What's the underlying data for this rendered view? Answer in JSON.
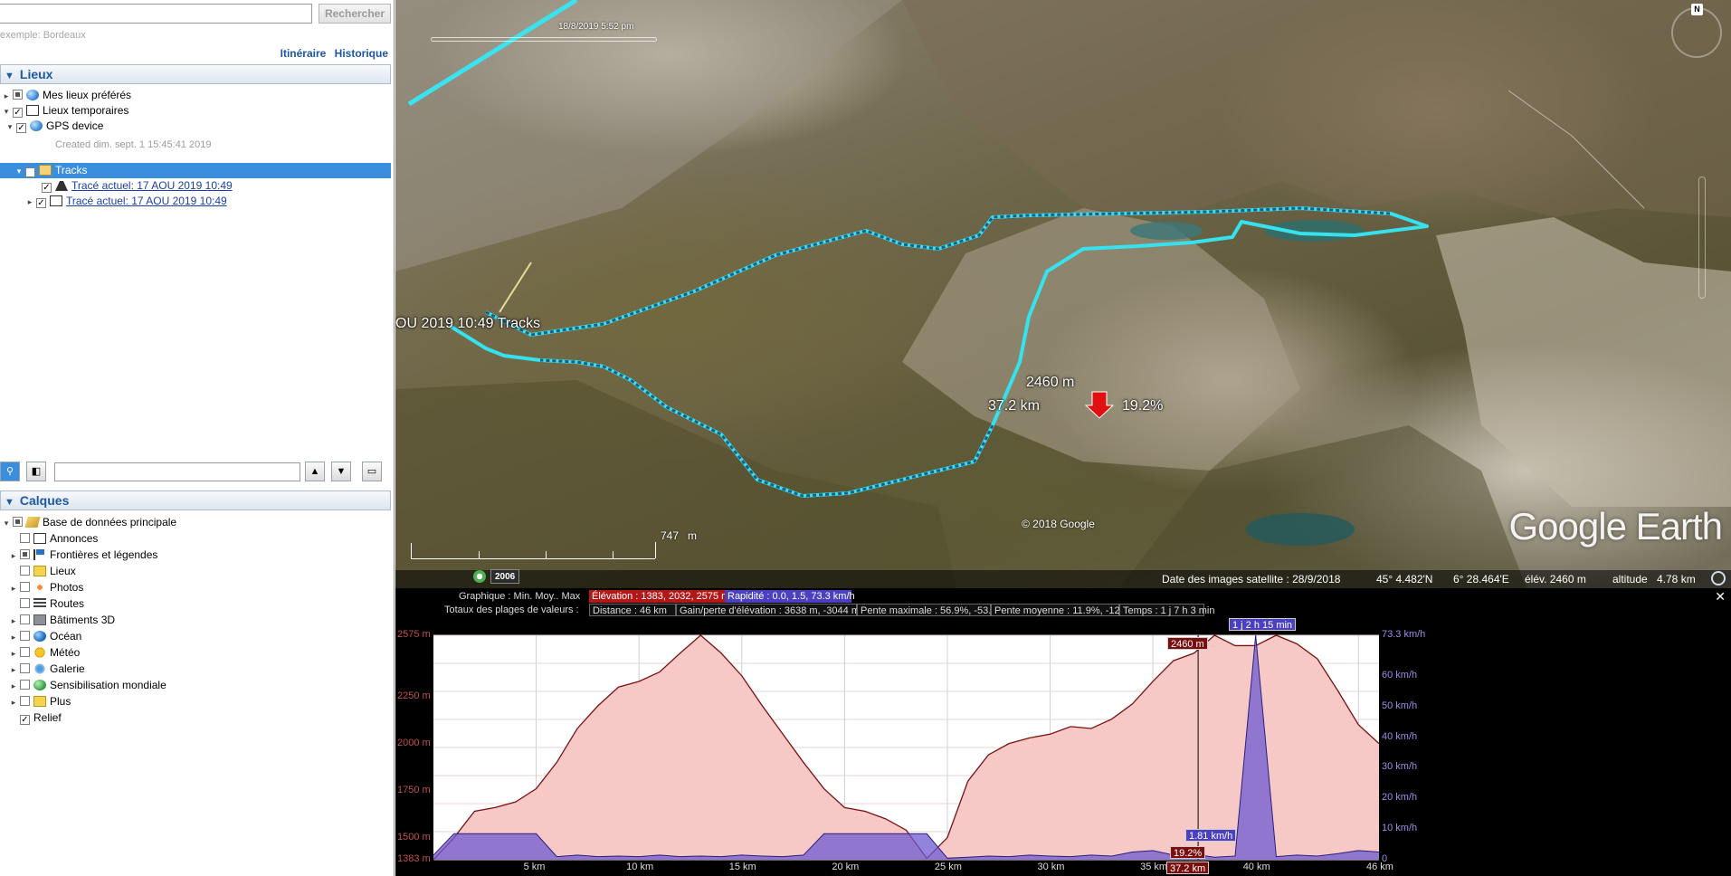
{
  "search": {
    "placeholder": "",
    "button_label": "Rechercher",
    "hint": "exemple: Bordeaux",
    "link_itinerary": "Itinéraire",
    "link_history": "Historique"
  },
  "places": {
    "header": "Lieux",
    "favorites": "Mes lieux préférés",
    "temporary": "Lieux temporaires",
    "gps_device": "GPS device",
    "created": "Created dim. sept. 1 15:45:41 2019",
    "tracks": "Tracks",
    "track1": "Tracé actuel: 17 AOU 2019 10:49",
    "track2": "Tracé actuel: 17 AOU 2019 10:49"
  },
  "layers": {
    "header": "Calques",
    "items": [
      "Base de données principale",
      "Annonces",
      "Frontières et légendes",
      "Lieux",
      "Photos",
      "Routes",
      "Bâtiments 3D",
      "Océan",
      "Météo",
      "Galerie",
      "Sensibilisation mondiale",
      "Plus",
      "Relief"
    ]
  },
  "view": {
    "time_label": "18/8/2019    5:52 pm",
    "compass_n": "N",
    "track_label": "OU 2019 10:49   Tracks",
    "marker_elev": "2460 m",
    "marker_dist": "37.2 km",
    "marker_slope": "19.2%",
    "copyright": "© 2018 Google",
    "logo": "Google Earth",
    "scale_value": "747",
    "scale_unit": "m",
    "year": "2006",
    "imagery_date": "Date des images satellite : 28/9/2018",
    "lat": "45° 4.482'N",
    "lon": "6° 28.464'E",
    "elev": "élév. 2460 m",
    "altitude_label": "altitude",
    "altitude_value": "4.78 km"
  },
  "profile": {
    "graph_label": "Graphique : Min. Moy.. Max",
    "elev_stat": "Élévation : 1383, 2032, 2575 m",
    "speed_stat": "Rapidité : 0.0, 1.5, 73.3 km/h",
    "totals_label": "Totaux des plages de valeurs :",
    "distance": "Distance : 46 km",
    "gain": "Gain/perte d'élévation : 3638 m, -3044 m",
    "max_slope": "Pente maximale : 56.9%, -53.9%",
    "avg_slope": "Pente moyenne : 11.9%, -12.2%",
    "time": "Temps : 1 j 7 h 3 min",
    "close": "✕",
    "cursor_time": "1 j 2 h 15 min",
    "cursor_elev": "2460 m",
    "cursor_speed": "1.81 km/h",
    "cursor_slope": "19.2%",
    "cursor_dist": "37.2 km",
    "y_left_ticks": [
      "2575 m",
      "2250 m",
      "2000 m",
      "1750 m",
      "1500 m",
      "1383 m"
    ],
    "y_right_ticks": [
      "73.3 km/h",
      "60 km/h",
      "50 km/h",
      "40 km/h",
      "30 km/h",
      "20 km/h",
      "10 km/h",
      "0"
    ],
    "x_ticks": [
      "5 km",
      "10 km",
      "15 km",
      "20 km",
      "25 km",
      "30 km",
      "35 km",
      "40 km",
      "46 km"
    ]
  },
  "chart_data": {
    "type": "area",
    "xlabel": "",
    "ylabel": "",
    "xlim": [
      0,
      46
    ],
    "ylim": [
      1383,
      2575
    ],
    "x": [
      0,
      1,
      2,
      3,
      4,
      5,
      6,
      7,
      8,
      9,
      10,
      11,
      12,
      13,
      14,
      15,
      16,
      17,
      18,
      19,
      20,
      21,
      22,
      23,
      24,
      25,
      26,
      27,
      28,
      29,
      30,
      31,
      32,
      33,
      34,
      35,
      36,
      37,
      38,
      39,
      40,
      41,
      42,
      43,
      44,
      45,
      46
    ],
    "series": [
      {
        "values": [
          1383,
          1500,
          1640,
          1660,
          1690,
          1760,
          1900,
          2080,
          2200,
          2300,
          2330,
          2380,
          2480,
          2575,
          2480,
          2360,
          2200,
          2050,
          1900,
          1760,
          1660,
          1640,
          1600,
          1540,
          1390,
          1500,
          1800,
          1940,
          2000,
          2030,
          2050,
          2090,
          2080,
          2130,
          2210,
          2330,
          2440,
          2480,
          2575,
          2520,
          2520,
          2575,
          2530,
          2450,
          2280,
          2100,
          2000
        ]
      },
      {
        "values": [
          1.5,
          8.5,
          8.5,
          8.5,
          8.5,
          8.5,
          1.0,
          1.5,
          1.0,
          1.2,
          1.0,
          1.5,
          1.0,
          1.2,
          1.0,
          1.5,
          1.2,
          1.0,
          1.5,
          8.5,
          8.5,
          8.5,
          8.5,
          8.5,
          8.5,
          0.5,
          0.8,
          1.2,
          1.0,
          1.5,
          1.2,
          1.0,
          1.5,
          1.2,
          2.5,
          3.0,
          1.5,
          1.8,
          0.8,
          1.2,
          73.3,
          1.0,
          1.5,
          1.2,
          2.0,
          3.0,
          2.5
        ]
      }
    ]
  }
}
